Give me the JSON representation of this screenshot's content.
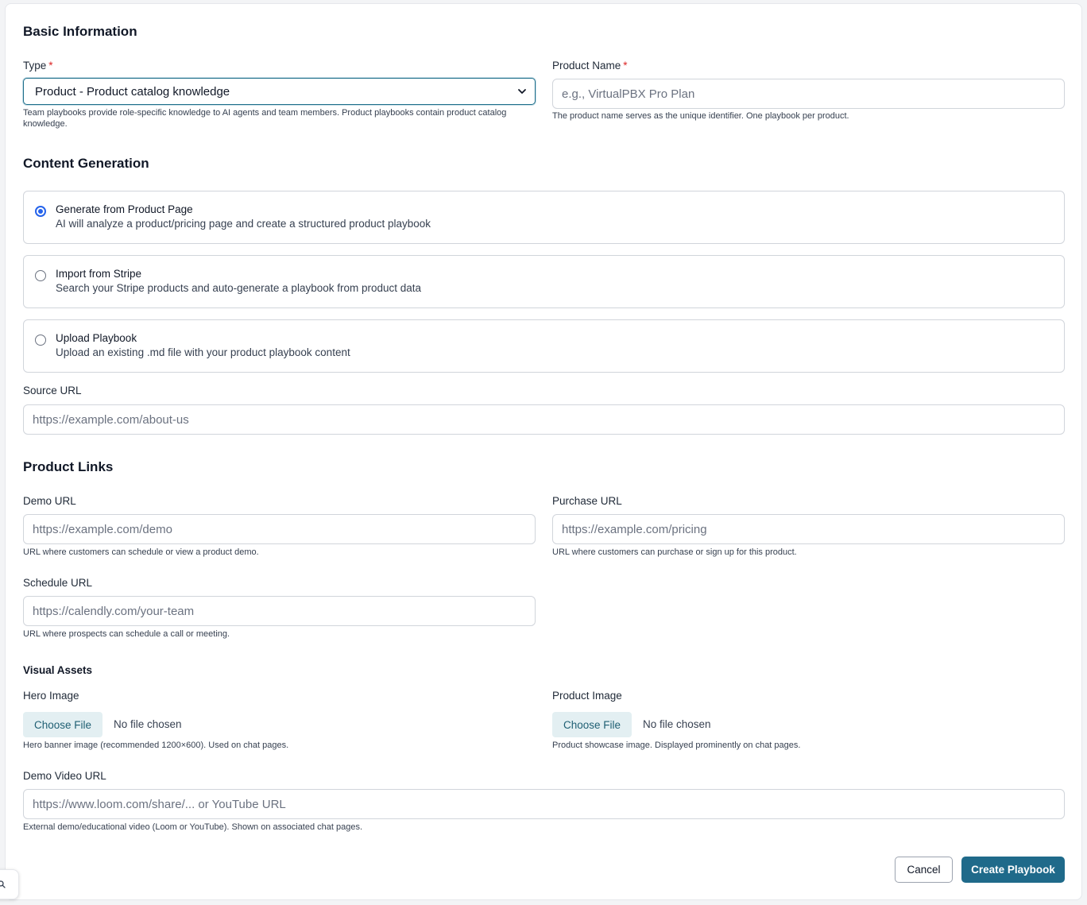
{
  "basic": {
    "title": "Basic Information",
    "type_label": "Type",
    "type_value": "Product - Product catalog knowledge",
    "type_help": "Team playbooks provide role-specific knowledge to AI agents and team members. Product playbooks contain product catalog knowledge.",
    "name_label": "Product Name",
    "name_placeholder": "e.g., VirtualPBX Pro Plan",
    "name_help": "The product name serves as the unique identifier. One playbook per product.",
    "required_mark": "*"
  },
  "content": {
    "title": "Content Generation",
    "options": [
      {
        "title": "Generate from Product Page",
        "desc": "AI will analyze a product/pricing page and create a structured product playbook",
        "selected": true
      },
      {
        "title": "Import from Stripe",
        "desc": "Search your Stripe products and auto-generate a playbook from product data",
        "selected": false
      },
      {
        "title": "Upload Playbook",
        "desc": "Upload an existing .md file with your product playbook content",
        "selected": false
      }
    ],
    "source_label": "Source URL",
    "source_placeholder": "https://example.com/about-us"
  },
  "links": {
    "title": "Product Links",
    "demo_label": "Demo URL",
    "demo_placeholder": "https://example.com/demo",
    "demo_help": "URL where customers can schedule or view a product demo.",
    "purchase_label": "Purchase URL",
    "purchase_placeholder": "https://example.com/pricing",
    "purchase_help": "URL where customers can purchase or sign up for this product.",
    "schedule_label": "Schedule URL",
    "schedule_placeholder": "https://calendly.com/your-team",
    "schedule_help": "URL where prospects can schedule a call or meeting."
  },
  "assets": {
    "title": "Visual Assets",
    "hero_label": "Hero Image",
    "hero_help": "Hero banner image (recommended 1200×600). Used on chat pages.",
    "product_label": "Product Image",
    "product_help": "Product showcase image. Displayed prominently on chat pages.",
    "choose_file": "Choose File",
    "no_file": "No file chosen",
    "video_label": "Demo Video URL",
    "video_placeholder": "https://www.loom.com/share/... or YouTube URL",
    "video_help": "External demo/educational video (Loom or YouTube). Shown on associated chat pages."
  },
  "actions": {
    "cancel": "Cancel",
    "create": "Create Playbook"
  },
  "icons": {
    "select": "chevron-down-icon",
    "corner": "search-icon"
  },
  "colors": {
    "primary": "#1f6a8a",
    "required": "#dc2626",
    "radio_selected": "#2563eb",
    "file_button_bg": "#e3eff2"
  }
}
